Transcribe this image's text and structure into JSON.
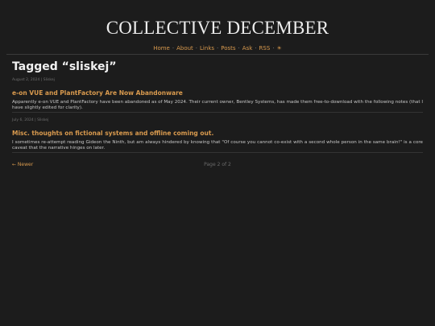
{
  "site": {
    "title": "COLLECTIVE DECEMBER"
  },
  "nav": {
    "items": [
      "Home",
      "About",
      "Links",
      "Posts",
      "Ask",
      "RSS",
      "☀"
    ],
    "separator": "·"
  },
  "page": {
    "heading": "Tagged “sliskej”"
  },
  "posts": [
    {
      "meta": "August 2, 2024 | Sliskej",
      "title": "e-on VUE and PlantFactory Are Now Abandonware",
      "body": "Apparently e-on VUE and PlantFactory have been abandoned as of May 2024. Their current owner, Bentley Systems, has made them free-to-download with the following notes (that I have slightly edited for clarity)."
    },
    {
      "meta": "July 6, 2024 | Sliskej",
      "title": "Misc. thoughts on fictional systems and offline coming out.",
      "body": "I sometimes re-attempt reading Gideon the Ninth, but am always hindered by knowing that \"Of course you cannot co-exist with a second whole person in the same brain!\" is a core caveat that the narrative hinges on later."
    }
  ],
  "pager": {
    "newer_label": "← Newer",
    "page_label": "Page 2 of 2"
  },
  "colors": {
    "background": "#1c1c1c",
    "accent": "#d99a4e",
    "text": "#cfcfcf"
  }
}
